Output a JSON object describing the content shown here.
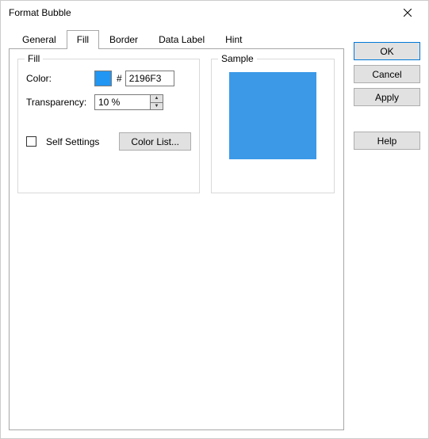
{
  "window": {
    "title": "Format Bubble"
  },
  "tabs": {
    "general": "General",
    "fill": "Fill",
    "border": "Border",
    "data_label": "Data Label",
    "hint": "Hint",
    "active": "fill"
  },
  "fill": {
    "legend": "Fill",
    "color_label": "Color:",
    "hash": "#",
    "hex_value": "2196F3",
    "color_swatch": "#2196F3",
    "transparency_label": "Transparency:",
    "transparency_value": "10 %",
    "self_settings_label": "Self Settings",
    "self_settings_checked": false,
    "color_list_label": "Color List..."
  },
  "sample": {
    "legend": "Sample",
    "color": "#3b99e8"
  },
  "buttons": {
    "ok": "OK",
    "cancel": "Cancel",
    "apply": "Apply",
    "help": "Help"
  }
}
